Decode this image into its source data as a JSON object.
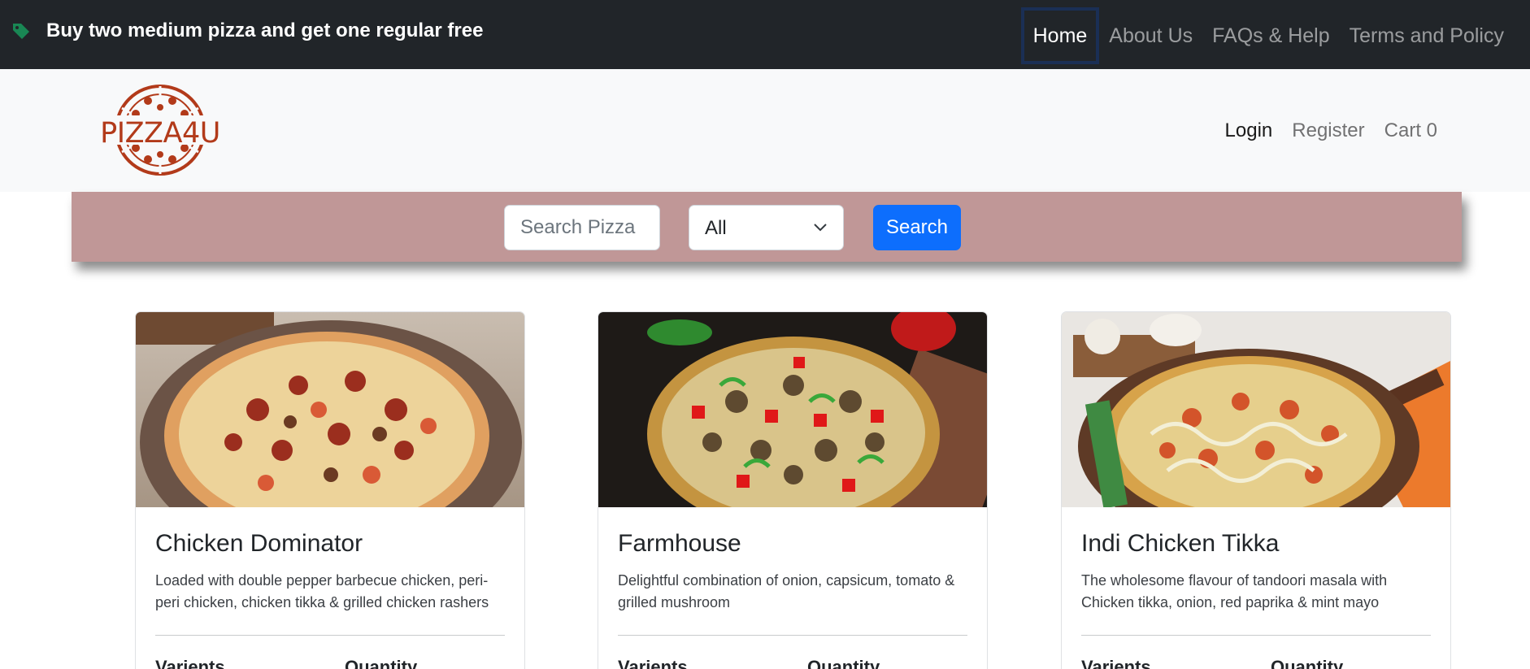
{
  "promo": {
    "text": "Buy two medium pizza and get one regular free",
    "icon": "tag-icon"
  },
  "topnav": [
    {
      "label": "Home",
      "active": true
    },
    {
      "label": "About Us",
      "active": false
    },
    {
      "label": "FAQs & Help",
      "active": false
    },
    {
      "label": "Terms and Policy",
      "active": false
    }
  ],
  "brand": {
    "name": "PIZZA4U",
    "color": "#b23a1a"
  },
  "usernav": {
    "login": "Login",
    "register": "Register",
    "cart": "Cart 0"
  },
  "search": {
    "placeholder": "Search Pizza",
    "value": "",
    "category": "All",
    "button": "Search"
  },
  "cards": [
    {
      "title": "Chicken Dominator",
      "description": "Loaded with double pepper barbecue chicken, peri-peri chicken, chicken tikka & grilled chicken rashers",
      "variants_label": "Varients",
      "quantity_label": "Quantity"
    },
    {
      "title": "Farmhouse",
      "description": "Delightful combination of onion, capsicum, tomato & grilled mushroom",
      "variants_label": "Varients",
      "quantity_label": "Quantity"
    },
    {
      "title": "Indi Chicken Tikka",
      "description": "The wholesome flavour of tandoori masala with Chicken tikka, onion, red paprika & mint mayo",
      "variants_label": "Varients",
      "quantity_label": "Quantity"
    }
  ],
  "colors": {
    "topbar": "#212529",
    "header": "#f8f9fa",
    "searchband": "#c09797",
    "primary": "#0d6efd",
    "tag": "#198754"
  }
}
